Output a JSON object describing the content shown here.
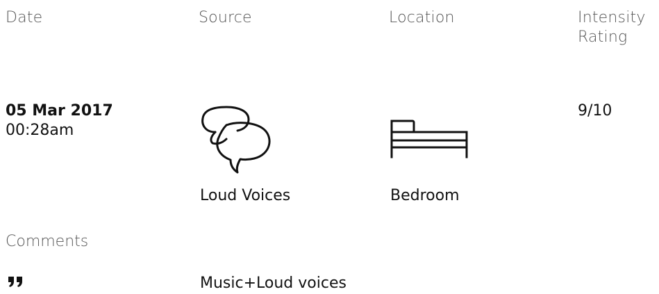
{
  "headers": {
    "date": "Date",
    "source": "Source",
    "location": "Location",
    "intensity_line1": "Intensity",
    "intensity_line2": "Rating"
  },
  "entry": {
    "date": "05 Mar 2017",
    "time": "00:28am",
    "source": {
      "label": "Loud Voices",
      "icon": "speech-bubbles-icon"
    },
    "location": {
      "label": "Bedroom",
      "icon": "bed-icon"
    },
    "intensity": "9/10"
  },
  "comments": {
    "header": "Comments",
    "icon": "quote-icon",
    "text": "Music+Loud voices"
  },
  "colors": {
    "header_text": "#555555",
    "body_text": "#111111",
    "background": "#ffffff"
  }
}
